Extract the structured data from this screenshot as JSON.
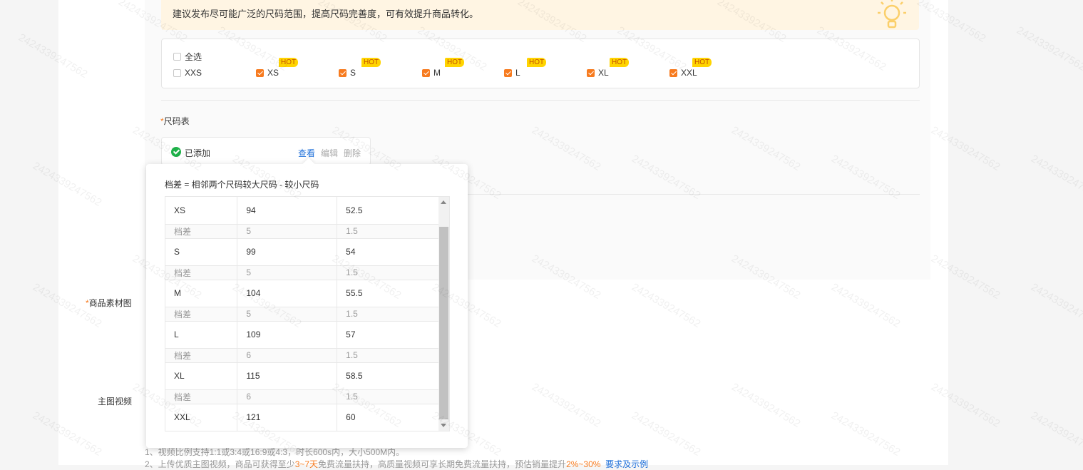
{
  "tip": {
    "text": "建议发布尽可能广泛的尺码范围，提高尺码完善度，可有效提升商品转化。",
    "icon": "lightbulb-icon"
  },
  "sizes": {
    "select_all_label": "全选",
    "hot_label": "HOT",
    "items": [
      {
        "label": "XXS",
        "checked": false,
        "hot": false
      },
      {
        "label": "XS",
        "checked": true,
        "hot": true
      },
      {
        "label": "S",
        "checked": true,
        "hot": true
      },
      {
        "label": "M",
        "checked": true,
        "hot": true
      },
      {
        "label": "L",
        "checked": true,
        "hot": true
      },
      {
        "label": "XL",
        "checked": true,
        "hot": true
      },
      {
        "label": "XXL",
        "checked": true,
        "hot": true
      }
    ]
  },
  "size_chart": {
    "required_mark": "*",
    "label": "尺码表",
    "status": "已添加",
    "actions": {
      "view": "查看",
      "edit": "编辑",
      "delete": "删除"
    }
  },
  "popover": {
    "title": "档差 = 相邻两个尺码较大尺码 - 较小尺码",
    "diff_label": "档差",
    "rows": [
      {
        "size": "XS",
        "v1": "94",
        "v2": "52.5",
        "d1": "5",
        "d2": "1.5"
      },
      {
        "size": "S",
        "v1": "99",
        "v2": "54",
        "d1": "5",
        "d2": "1.5"
      },
      {
        "size": "M",
        "v1": "104",
        "v2": "55.5",
        "d1": "5",
        "d2": "1.5"
      },
      {
        "size": "L",
        "v1": "109",
        "v2": "57",
        "d1": "6",
        "d2": "1.5"
      },
      {
        "size": "XL",
        "v1": "115",
        "v2": "58.5",
        "d1": "6",
        "d2": "1.5"
      },
      {
        "size": "XXL",
        "v1": "121",
        "v2": "60",
        "d1": null,
        "d2": null
      }
    ]
  },
  "form": {
    "material_label": "商品素材图",
    "required_mark": "*",
    "video_label": "主图视频",
    "note1": "1、视频比例支持1:1或3:4或16:9或4:3，时长600s内，大小500M内。",
    "note2_prefix": "2、上传优质主图视频，商品可获得至少",
    "note2_highlight1": "3~7天",
    "note2_middle": "免费流量扶持，高质量视频可享长期免费流量扶持，预估销量提升",
    "note2_highlight2": "2%~30%",
    "note2_link": "要求及示例"
  },
  "watermark": "2424339247562",
  "colors": {
    "accent": "#f77b1f",
    "link": "#1e6fd9",
    "success": "#1fb34a",
    "hot": "#ffd400"
  }
}
